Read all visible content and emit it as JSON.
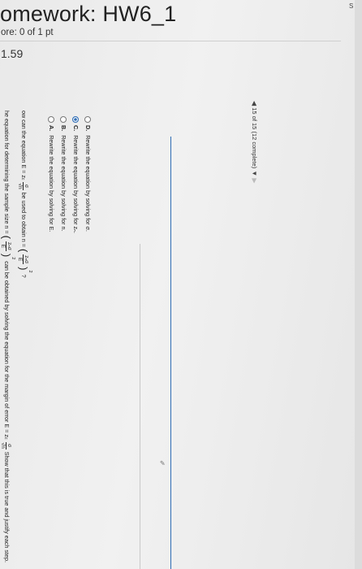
{
  "header": {
    "title": "omework: HW6_1",
    "score": "ore: 0 of 1 pt",
    "question_number": "1.59",
    "corner_label": "S"
  },
  "navigation": {
    "progress": "15 of 15 (12 complete)"
  },
  "question": {
    "line1_prefix": "he equation for determining the sample size n =",
    "line1_mid": "can be obtained by solving the equation for the margin of error E = z",
    "line1_suffix": "Show that this is true and justify each step.",
    "line2_prefix": "ow can the equation E = z",
    "line2_mid": "be used to obtain n =",
    "line2_suffix": "?",
    "frac_z_sigma": "zₙσ",
    "frac_E": "E",
    "frac_sigma": "σ",
    "frac_sqrt_n": "√n",
    "sub_c": "c",
    "sq": "2"
  },
  "options": [
    {
      "letter": "A.",
      "text": "Rewrite the equation by solving for E.",
      "selected": false
    },
    {
      "letter": "B.",
      "text": "Rewrite the equation by solving for n.",
      "selected": false
    },
    {
      "letter": "C.",
      "text": "Rewrite the equation by solving for zₙ.",
      "selected": true
    },
    {
      "letter": "D.",
      "text": "Rewrite the equation by solving for σ.",
      "selected": false
    }
  ],
  "colors": {
    "accent": "#2f6db5"
  }
}
